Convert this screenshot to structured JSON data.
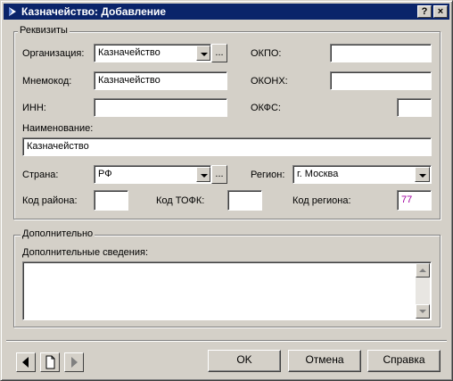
{
  "window": {
    "title": "Казначейство: Добавление",
    "help_glyph": "?",
    "close_glyph": "×"
  },
  "requisites": {
    "legend": "Реквизиты",
    "organization": {
      "label": "Организация:",
      "value": "Казначейство",
      "ellipsis": "..."
    },
    "mnemocode": {
      "label": "Мнемокод:",
      "value": "Казначейство"
    },
    "inn": {
      "label": "ИНН:",
      "value": ""
    },
    "okpo": {
      "label": "ОКПО:",
      "value": ""
    },
    "okonh": {
      "label": "ОКОНХ:",
      "value": ""
    },
    "okfs": {
      "label": "ОКФС:",
      "value": ""
    },
    "name": {
      "label": "Наименование:",
      "value": "Казначейство"
    },
    "country": {
      "label": "Страна:",
      "value": "РФ",
      "ellipsis": "..."
    },
    "region": {
      "label": "Регион:",
      "value": "г. Москва"
    },
    "district_code": {
      "label": "Код района:",
      "value": ""
    },
    "tofk_code": {
      "label": "Код ТОФК:",
      "value": ""
    },
    "region_code": {
      "label": "Код региона:",
      "value": "77",
      "color": "#a000a0"
    }
  },
  "additional": {
    "legend": "Дополнительно",
    "info": {
      "label": "Дополнительные сведения:",
      "value": ""
    }
  },
  "footer": {
    "ok_label": "OK",
    "cancel_label": "Отмена",
    "help_label": "Справка"
  },
  "colors": {
    "titlebar": "#0a246a",
    "face": "#d4d0c8",
    "region_code_text": "#a000a0"
  }
}
